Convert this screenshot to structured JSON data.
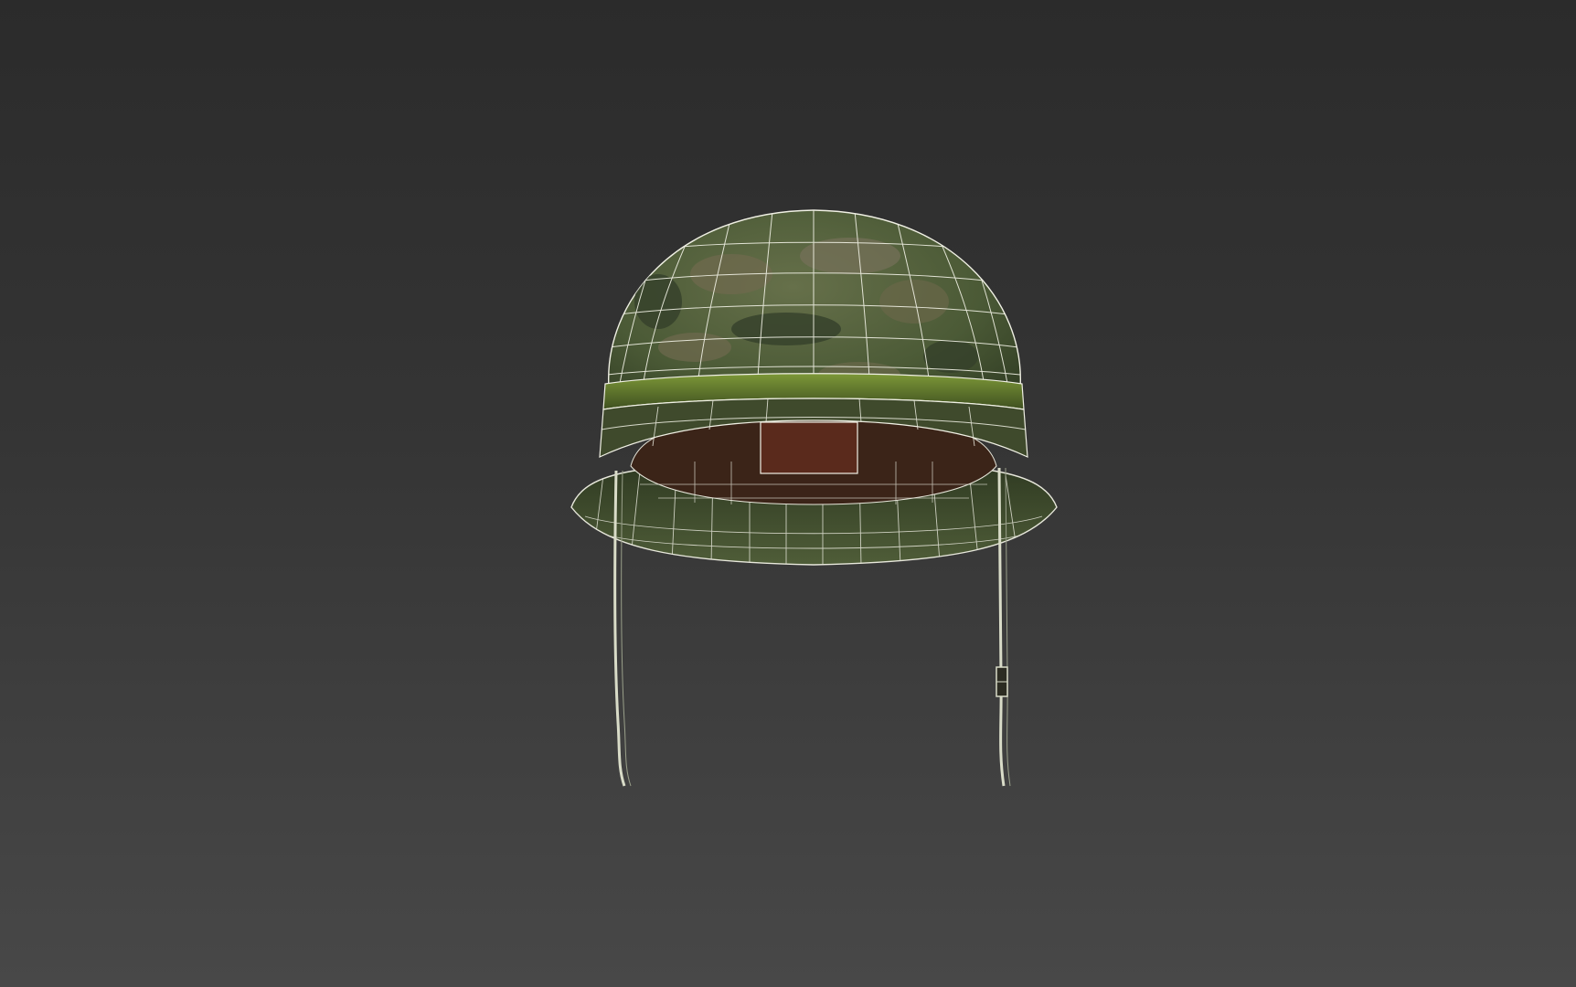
{
  "viewport": {
    "background_top": "#2b2b2b",
    "background_bottom": "#484848"
  },
  "model": {
    "name_icon": "helmet-model",
    "shell_color": "#4b5a36",
    "shell_dark": "#2e3a22",
    "camo_light": "#6f6a4e",
    "camo_dark": "#34402a",
    "band_color": "#5e7a2a",
    "liner_color": "#5a2a1c",
    "wire_color": "#f2f2e6",
    "strap_color": "#d9dcc8"
  }
}
